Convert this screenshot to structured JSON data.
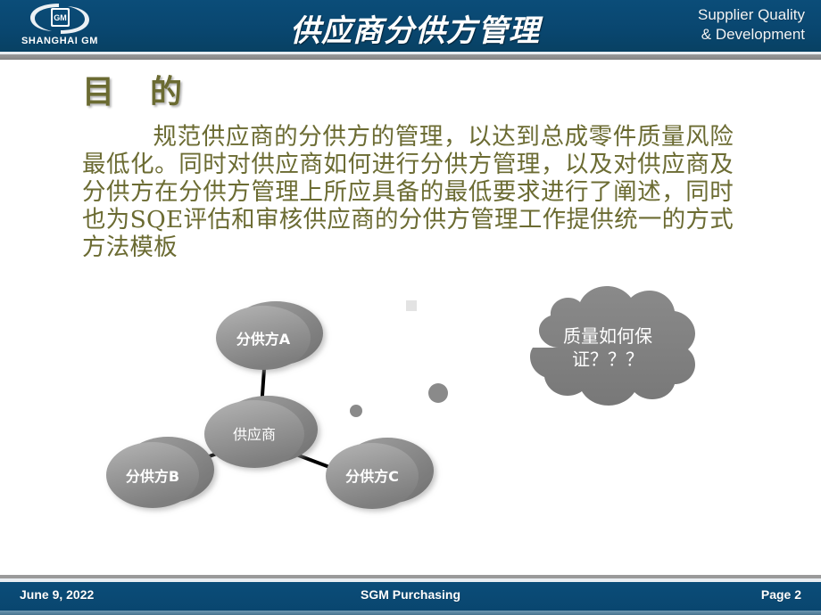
{
  "header": {
    "logo_text": "SHANGHAI GM",
    "logo_emblem": "GM",
    "title": "供应商分供方管理",
    "subtitle_line1": "Supplier Quality",
    "subtitle_line2": "& Development",
    "bar_color": "#0a4b77"
  },
  "content": {
    "heading": "目　的",
    "heading_color": "#6b6b32",
    "body": "规范供应商的分供方的管理，以达到总成零件质量风险最低化。同时对供应商如何进行分供方管理，以及对供应商及分供方在分供方管理上所应具备的最低要求进行了阐述，同时也为SQE评估和审核供应商的分供方管理工作提供统一的方式方法模板"
  },
  "diagram": {
    "node_color": "#8f8f8f",
    "node_text_color": "#ffffff",
    "connector_color": "#000000",
    "nodes": [
      {
        "id": "supplier-a",
        "label": "分供方A"
      },
      {
        "id": "supplier-main",
        "label": "供应商"
      },
      {
        "id": "supplier-b",
        "label": "分供方B"
      },
      {
        "id": "supplier-c",
        "label": "分供方C"
      }
    ],
    "callout": {
      "line1": "质量如何保",
      "line2": "证？？？",
      "fill": "#808080",
      "text_color": "#ffffff"
    }
  },
  "footer": {
    "date": "June 9, 2022",
    "center": "SGM Purchasing",
    "page": "Page 2",
    "bar_color": "#0a4b77"
  }
}
